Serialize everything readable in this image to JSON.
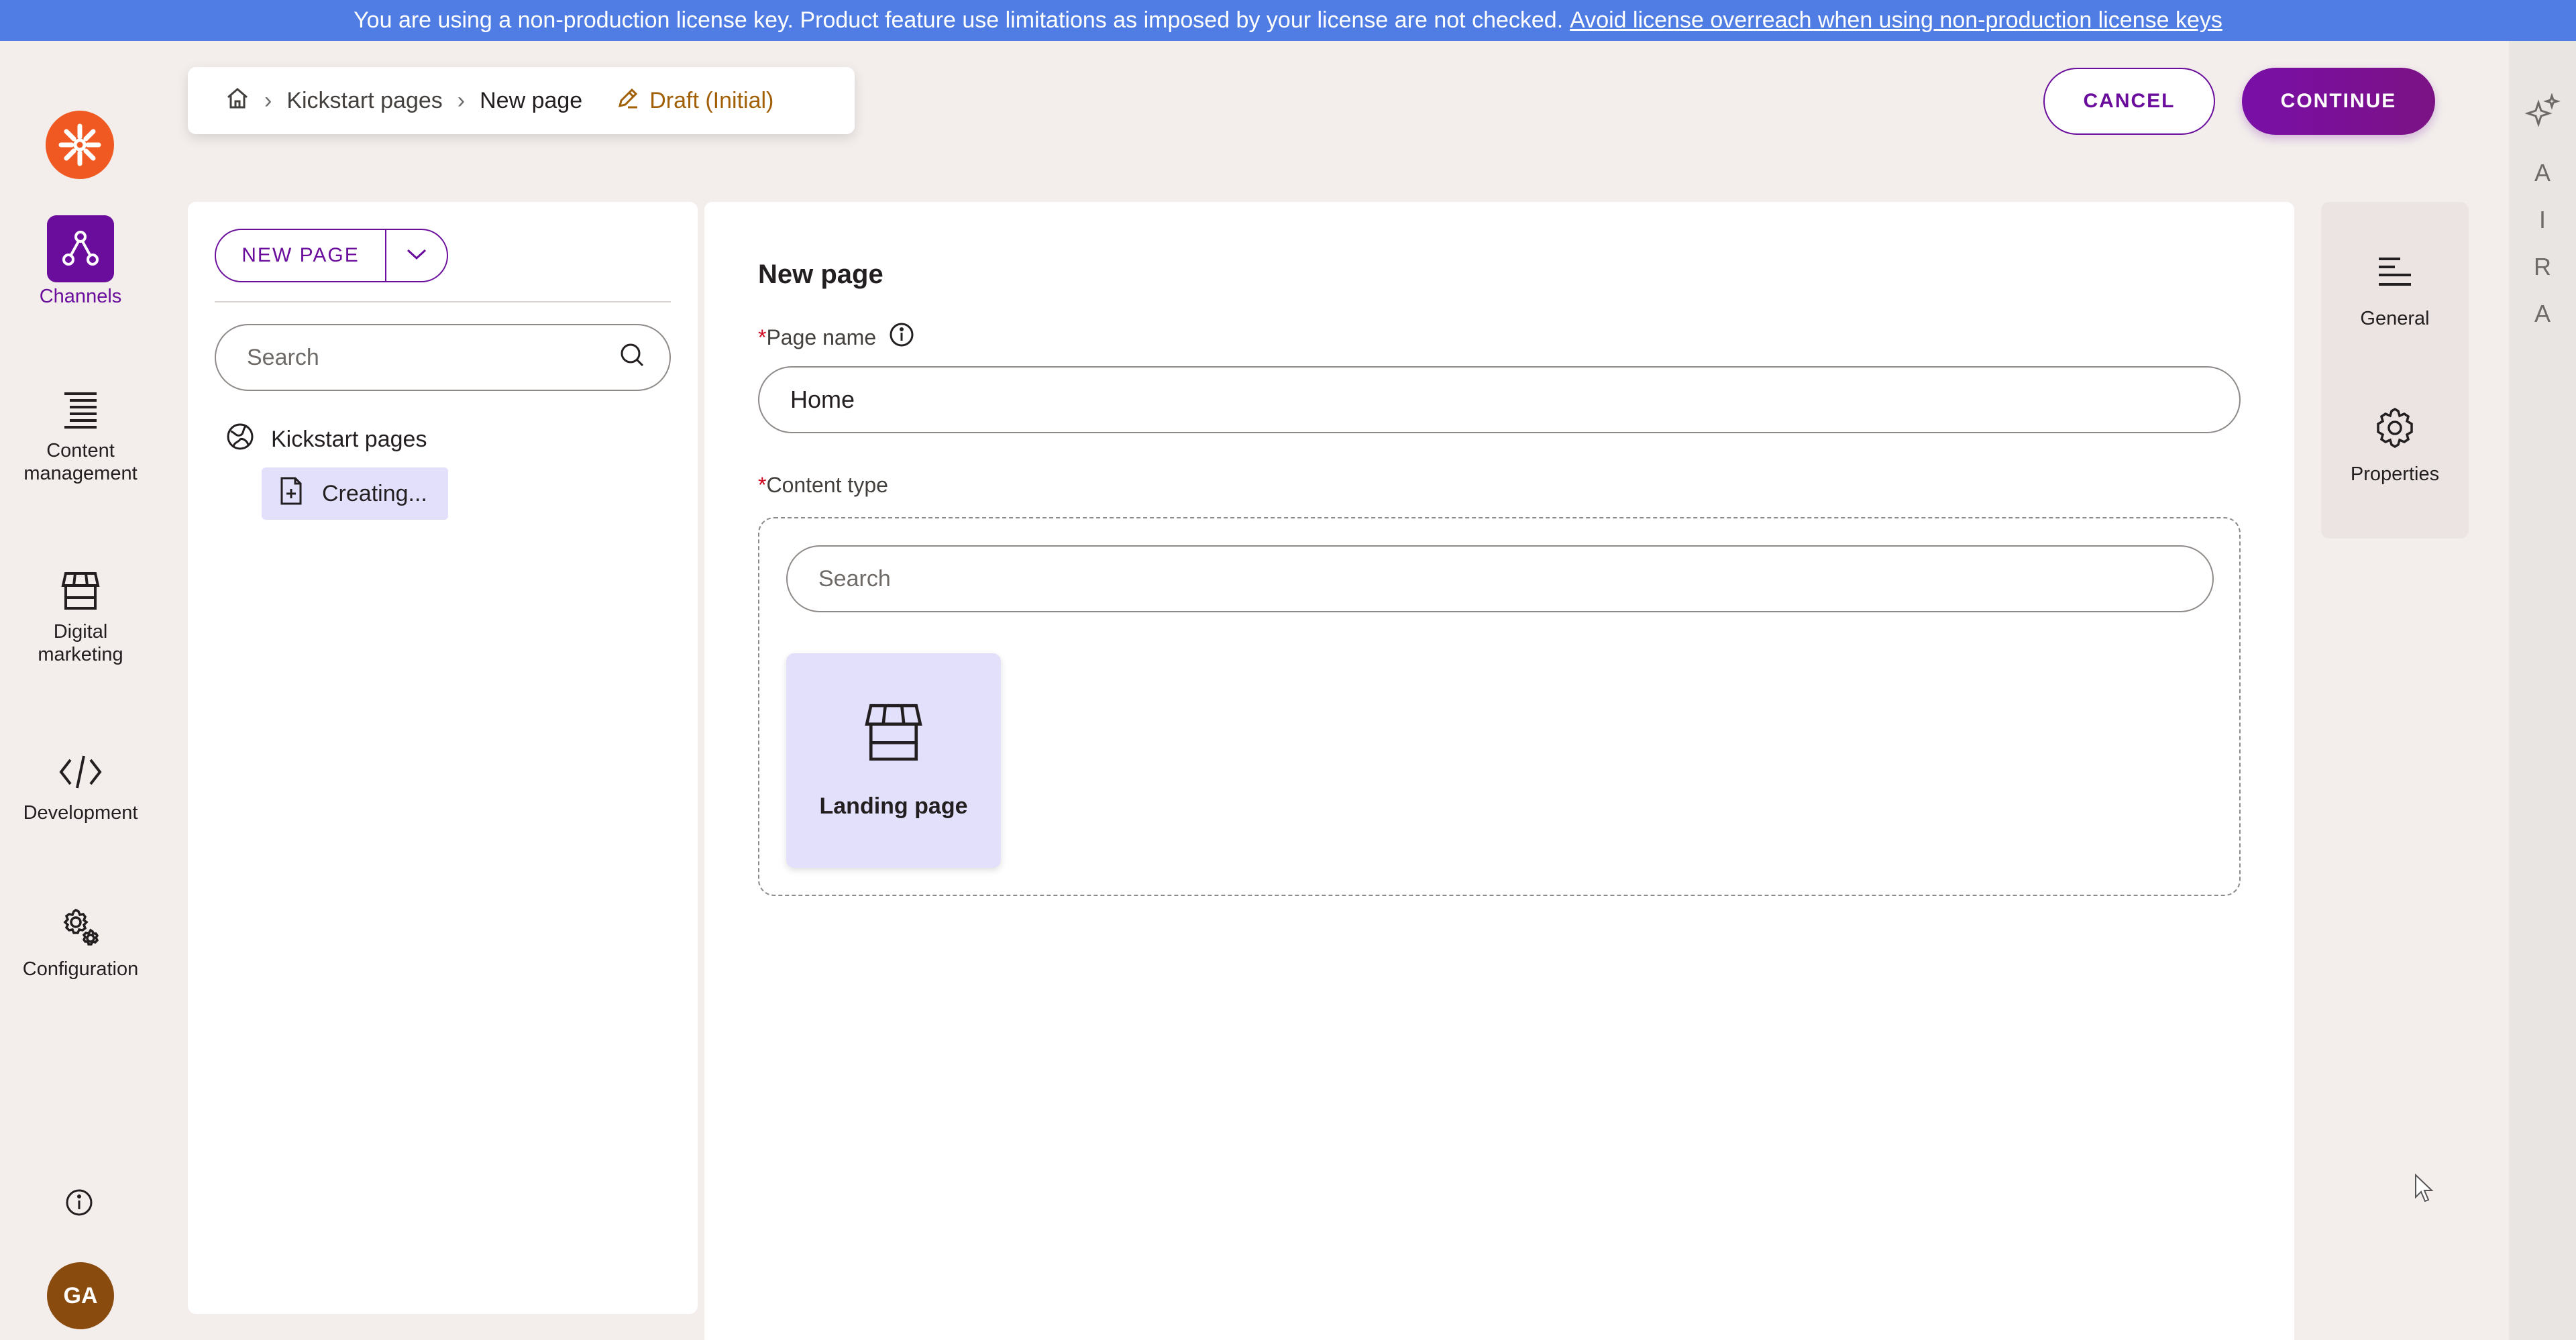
{
  "banner": {
    "text": "You are using a non-production license key. Product feature use limitations as imposed by your license are not checked.",
    "link": "Avoid license overreach when using non-production license keys"
  },
  "nav": {
    "logo_icon": "kentico-logo-icon",
    "items": [
      {
        "label": "Channels",
        "icon": "channels-icon",
        "active": true
      },
      {
        "label": "Content management",
        "icon": "content-management-icon",
        "active": false
      },
      {
        "label": "Digital marketing",
        "icon": "store-icon",
        "active": false
      },
      {
        "label": "Development",
        "icon": "code-icon",
        "active": false
      },
      {
        "label": "Configuration",
        "icon": "gears-icon",
        "active": false
      }
    ],
    "avatar_initials": "GA"
  },
  "breadcrumb": {
    "home_icon": "home-icon",
    "items": [
      "Kickstart pages",
      "New page"
    ],
    "status": "Draft (Initial)"
  },
  "actions": {
    "cancel": "CANCEL",
    "continue": "CONTINUE"
  },
  "tree": {
    "new_page_label": "NEW PAGE",
    "search_placeholder": "Search",
    "root_label": "Kickstart pages",
    "child_label": "Creating..."
  },
  "form": {
    "title": "New page",
    "page_name_label": "Page name",
    "page_name_value": "Home",
    "content_type_label": "Content type",
    "content_type_search_placeholder": "Search",
    "content_types": [
      {
        "label": "Landing page",
        "icon": "store-icon"
      }
    ]
  },
  "right_tabs": [
    {
      "label": "General",
      "icon": "align-left-icon"
    },
    {
      "label": "Properties",
      "icon": "gear-icon"
    }
  ],
  "aira": {
    "letters": [
      "A",
      "I",
      "R",
      "A"
    ],
    "icon": "sparkles-icon"
  },
  "colors": {
    "accent": "#6b0d9c",
    "banner": "#4f7de3",
    "logo": "#f05a22",
    "tile_bg": "#e3e0fb",
    "draft": "#a26006",
    "required": "#d0021b"
  }
}
